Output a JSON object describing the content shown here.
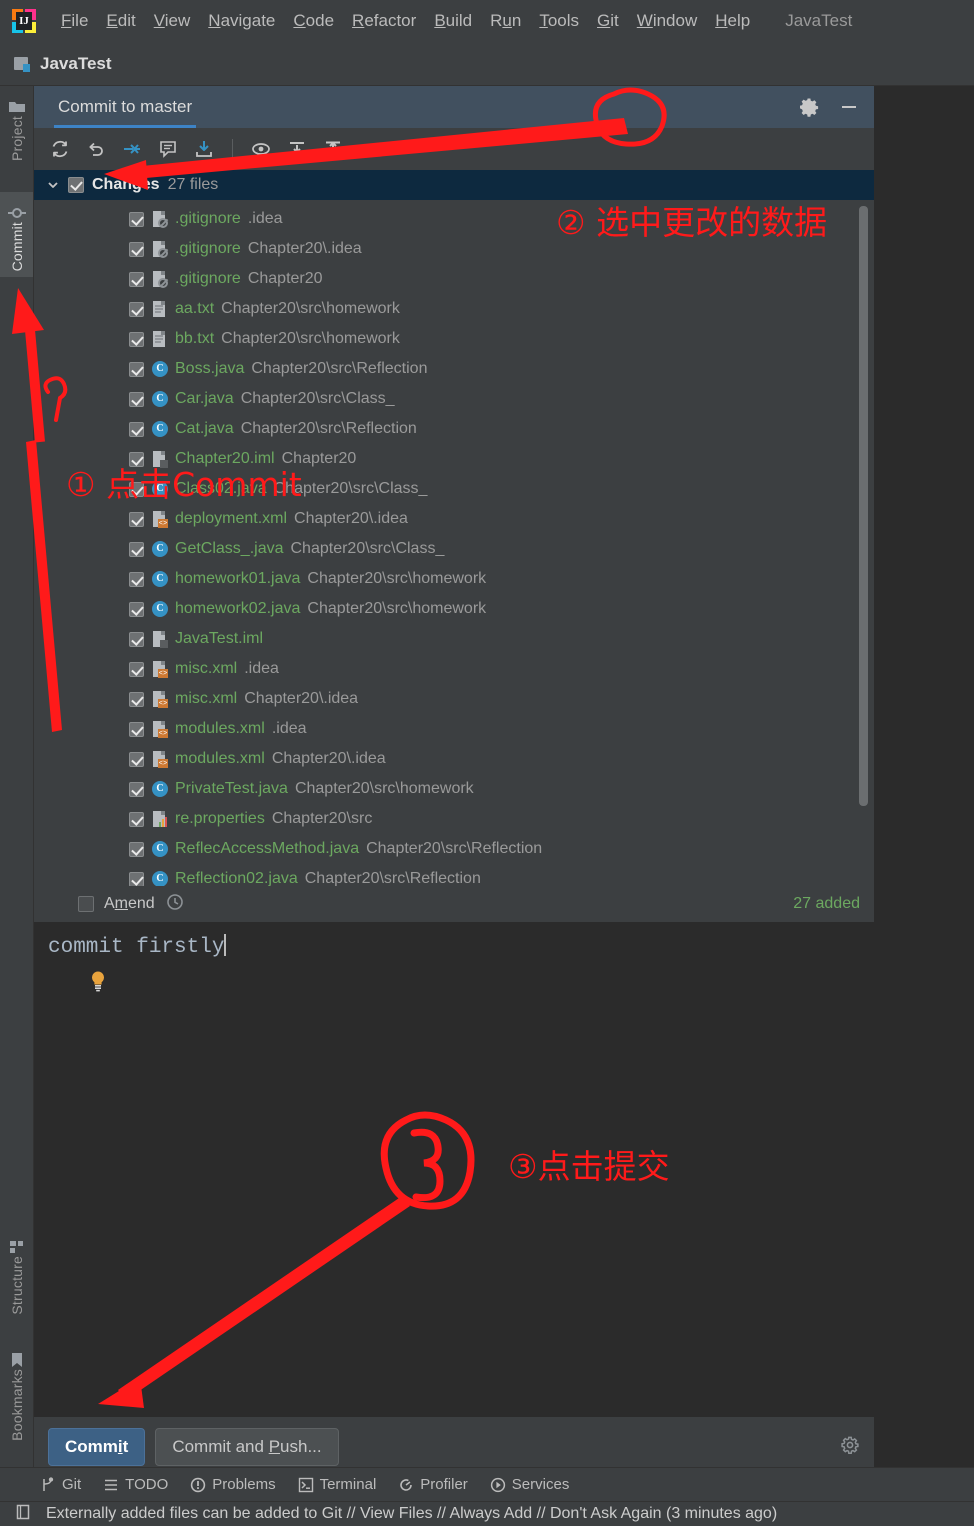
{
  "menubar": {
    "logo_letters": "IJ",
    "items": [
      {
        "name": "file",
        "pre": "",
        "key": "F",
        "post": "ile"
      },
      {
        "name": "edit",
        "pre": "",
        "key": "E",
        "post": "dit"
      },
      {
        "name": "view",
        "pre": "",
        "key": "V",
        "post": "iew"
      },
      {
        "name": "navigate",
        "pre": "",
        "key": "N",
        "post": "avigate"
      },
      {
        "name": "code",
        "pre": "",
        "key": "C",
        "post": "ode"
      },
      {
        "name": "refactor",
        "pre": "",
        "key": "R",
        "post": "efactor"
      },
      {
        "name": "build",
        "pre": "",
        "key": "B",
        "post": "uild"
      },
      {
        "name": "run",
        "pre": "R",
        "key": "u",
        "post": "n"
      },
      {
        "name": "tools",
        "pre": "",
        "key": "T",
        "post": "ools"
      },
      {
        "name": "git",
        "pre": "",
        "key": "G",
        "post": "it"
      },
      {
        "name": "window",
        "pre": "",
        "key": "W",
        "post": "indow"
      },
      {
        "name": "help",
        "pre": "",
        "key": "H",
        "post": "elp"
      }
    ],
    "project_label": "JavaTest"
  },
  "projectbar": {
    "title": "JavaTest"
  },
  "left_stripe": {
    "top_items": [
      {
        "label": "Project",
        "icon": "folder-icon",
        "selected": false
      },
      {
        "label": "Commit",
        "icon": "commit-icon",
        "selected": true
      }
    ],
    "bottom_items": [
      {
        "label": "Structure",
        "icon": "structure-icon",
        "selected": false
      },
      {
        "label": "Bookmarks",
        "icon": "bookmark-icon",
        "selected": false
      }
    ]
  },
  "commit_window": {
    "tab_title": "Commit to master",
    "header_icons": [
      "gear-icon",
      "minimize-icon"
    ],
    "toolbar_icons": [
      "refresh-icon",
      "rollback-icon",
      "show-diff-icon",
      "commit-message-icon",
      "update-project-icon",
      "preview-diff-icon",
      "expand-all-icon",
      "collapse-all-icon"
    ],
    "changes": {
      "title": "Changes",
      "count_label": "27 files",
      "checked": true,
      "expanded": true
    },
    "files": [
      {
        "name": ".gitignore",
        "path": ".idea",
        "icon": "ignored-file-icon",
        "checked": true
      },
      {
        "name": ".gitignore",
        "path": "Chapter20\\.idea",
        "icon": "ignored-file-icon",
        "checked": true
      },
      {
        "name": ".gitignore",
        "path": "Chapter20",
        "icon": "ignored-file-icon",
        "checked": true
      },
      {
        "name": "aa.txt",
        "path": "Chapter20\\src\\homework",
        "icon": "text-file-icon",
        "checked": true
      },
      {
        "name": "bb.txt",
        "path": "Chapter20\\src\\homework",
        "icon": "text-file-icon",
        "checked": true
      },
      {
        "name": "Boss.java",
        "path": "Chapter20\\src\\Reflection",
        "icon": "java-class-icon",
        "checked": true
      },
      {
        "name": "Car.java",
        "path": "Chapter20\\src\\Class_",
        "icon": "java-class-icon",
        "checked": true
      },
      {
        "name": "Cat.java",
        "path": "Chapter20\\src\\Reflection",
        "icon": "java-class-icon",
        "checked": true
      },
      {
        "name": "Chapter20.iml",
        "path": "Chapter20",
        "icon": "iml-file-icon",
        "checked": true
      },
      {
        "name": "Class02.java",
        "path": "Chapter20\\src\\Class_",
        "icon": "java-class-icon",
        "checked": true
      },
      {
        "name": "deployment.xml",
        "path": "Chapter20\\.idea",
        "icon": "xml-file-icon",
        "checked": true
      },
      {
        "name": "GetClass_.java",
        "path": "Chapter20\\src\\Class_",
        "icon": "java-class-icon",
        "checked": true
      },
      {
        "name": "homework01.java",
        "path": "Chapter20\\src\\homework",
        "icon": "java-class-icon",
        "checked": true
      },
      {
        "name": "homework02.java",
        "path": "Chapter20\\src\\homework",
        "icon": "java-class-icon",
        "checked": true
      },
      {
        "name": "JavaTest.iml",
        "path": "",
        "icon": "iml-file-icon",
        "checked": true
      },
      {
        "name": "misc.xml",
        "path": ".idea",
        "icon": "xml-file-icon",
        "checked": true
      },
      {
        "name": "misc.xml",
        "path": "Chapter20\\.idea",
        "icon": "xml-file-icon",
        "checked": true
      },
      {
        "name": "modules.xml",
        "path": ".idea",
        "icon": "xml-file-icon",
        "checked": true
      },
      {
        "name": "modules.xml",
        "path": "Chapter20\\.idea",
        "icon": "xml-file-icon",
        "checked": true
      },
      {
        "name": "PrivateTest.java",
        "path": "Chapter20\\src\\homework",
        "icon": "java-class-icon",
        "checked": true
      },
      {
        "name": "re.properties",
        "path": "Chapter20\\src",
        "icon": "properties-icon",
        "checked": true
      },
      {
        "name": "ReflecAccessMethod.java",
        "path": "Chapter20\\src\\Reflection",
        "icon": "java-class-icon",
        "checked": true
      },
      {
        "name": "Reflection02.java",
        "path": "Chapter20\\src\\Reflection",
        "icon": "java-class-icon",
        "checked": true
      }
    ],
    "amend": {
      "label_pre": "A",
      "label_key": "m",
      "label_post": "end",
      "checked": false,
      "history_icon": "history-clock-icon"
    },
    "added_status": "27 added",
    "message": {
      "value": "commit firstly",
      "hint_icon": "lightbulb-icon"
    },
    "buttons": {
      "commit": {
        "pre": "Comm",
        "key": "i",
        "post": "t"
      },
      "commit_and_push": {
        "pre": "Commit and ",
        "key": "P",
        "post": "ush..."
      },
      "settings_icon": "gear-icon"
    }
  },
  "bottom_toolbar": {
    "items": [
      {
        "label": "Git",
        "icon": "git-branch-icon"
      },
      {
        "label": "TODO",
        "icon": "todo-list-icon"
      },
      {
        "label": "Problems",
        "icon": "problems-icon"
      },
      {
        "label": "Terminal",
        "icon": "terminal-icon"
      },
      {
        "label": "Profiler",
        "icon": "profiler-icon"
      },
      {
        "label": "Services",
        "icon": "services-icon"
      }
    ]
  },
  "statusbar": {
    "icon": "notification-icon",
    "text": "Externally added files can be added to Git // View Files // Always Add // Don't Ask Again (3 minutes ago)"
  },
  "annotations": {
    "color": "#ff1a1a",
    "step1": "① 点击Commit",
    "step2": "② 选中更改的数据",
    "step3": "③点击提交"
  },
  "colors": {
    "accent_blue": "#3592c4",
    "added_green": "#6ca860",
    "annotation_red": "#ff1a1a",
    "panel_bg": "#3c3f41",
    "editor_bg": "#2b2b2b",
    "tab_header_bg": "#41505f",
    "selection_navy": "#0d293f"
  }
}
